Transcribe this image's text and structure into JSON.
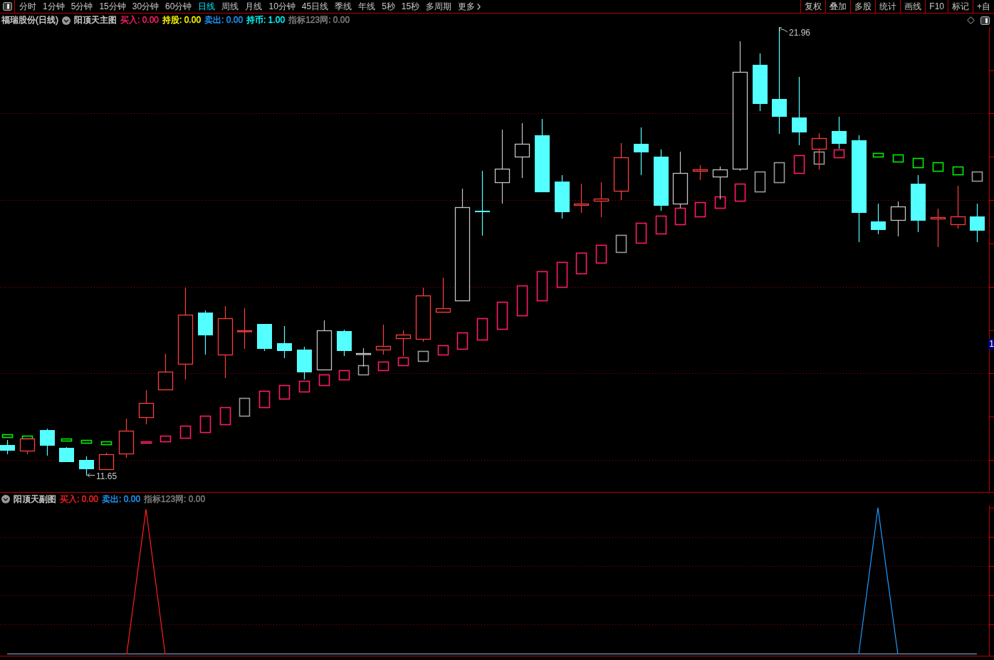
{
  "toolbar": {
    "periods": [
      {
        "label": "分时",
        "selected": false
      },
      {
        "label": "1分钟",
        "selected": false
      },
      {
        "label": "5分钟",
        "selected": false
      },
      {
        "label": "15分钟",
        "selected": false
      },
      {
        "label": "30分钟",
        "selected": false
      },
      {
        "label": "60分钟",
        "selected": false
      },
      {
        "label": "日线",
        "selected": true
      },
      {
        "label": "周线",
        "selected": false
      },
      {
        "label": "月线",
        "selected": false
      },
      {
        "label": "10分钟",
        "selected": false
      },
      {
        "label": "45日线",
        "selected": false
      },
      {
        "label": "季线",
        "selected": false
      },
      {
        "label": "年线",
        "selected": false
      },
      {
        "label": "5秒",
        "selected": false
      },
      {
        "label": "15秒",
        "selected": false
      },
      {
        "label": "多周期",
        "selected": false
      }
    ],
    "more": "更多",
    "actions": [
      "复权",
      "叠加",
      "多股",
      "统计",
      "画线",
      "F10",
      "标记",
      "+自"
    ]
  },
  "main_chart": {
    "title": "福瑞股份(日线)",
    "indicator": "阳顶天主图",
    "readouts": [
      {
        "text": "买入: 0.00",
        "color": "#ff2070"
      },
      {
        "text": "持股: 0.00",
        "color": "#ffff00"
      },
      {
        "text": "卖出: 0.00",
        "color": "#1e9bff"
      },
      {
        "text": "持币: 1.00",
        "color": "#00ffff"
      },
      {
        "text": "指标123网: 0.00",
        "color": "#808080"
      }
    ],
    "high_label": "21.96",
    "low_label": "11.65",
    "price_marker": "1"
  },
  "sub_chart": {
    "indicator": "阳顶天副图",
    "readouts": [
      {
        "text": "买入: 0.00",
        "color": "#ff2020"
      },
      {
        "text": "卖出: 0.00",
        "color": "#1e9bff"
      },
      {
        "text": "指标123网: 0.00",
        "color": "#808080"
      }
    ]
  }
}
